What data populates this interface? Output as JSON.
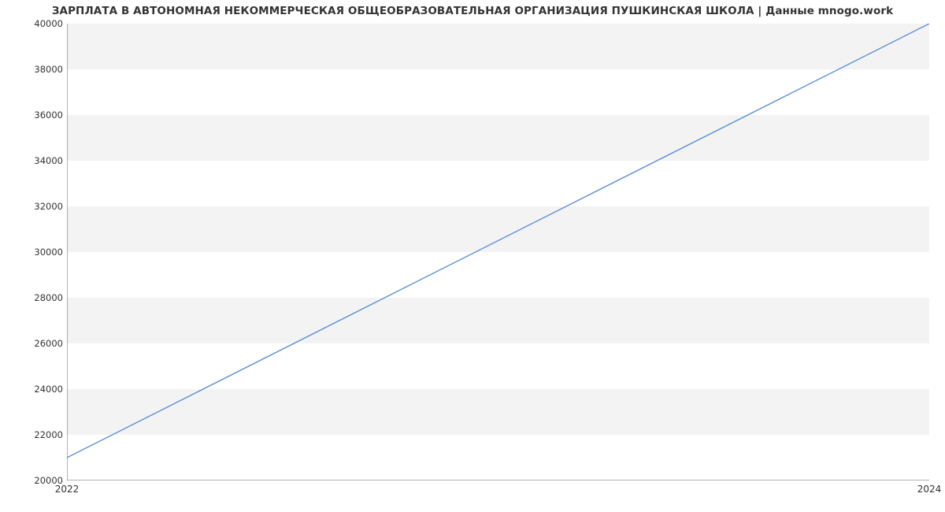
{
  "chart_data": {
    "type": "line",
    "title": "ЗАРПЛАТА В АВТОНОМНАЯ НЕКОММЕРЧЕСКАЯ ОБЩЕОБРАЗОВАТЕЛЬНАЯ ОРГАНИЗАЦИЯ ПУШКИНСКАЯ ШКОЛА | Данные mnogo.work",
    "xlabel": "",
    "ylabel": "",
    "x": [
      2022,
      2024
    ],
    "values": [
      21000,
      40000
    ],
    "x_ticks": [
      2022,
      2024
    ],
    "y_ticks": [
      20000,
      22000,
      24000,
      26000,
      28000,
      30000,
      32000,
      34000,
      36000,
      38000,
      40000
    ],
    "xlim": [
      2022,
      2024
    ],
    "ylim": [
      20000,
      40000
    ],
    "grid": "y",
    "line_color": "#5b8fd6"
  }
}
